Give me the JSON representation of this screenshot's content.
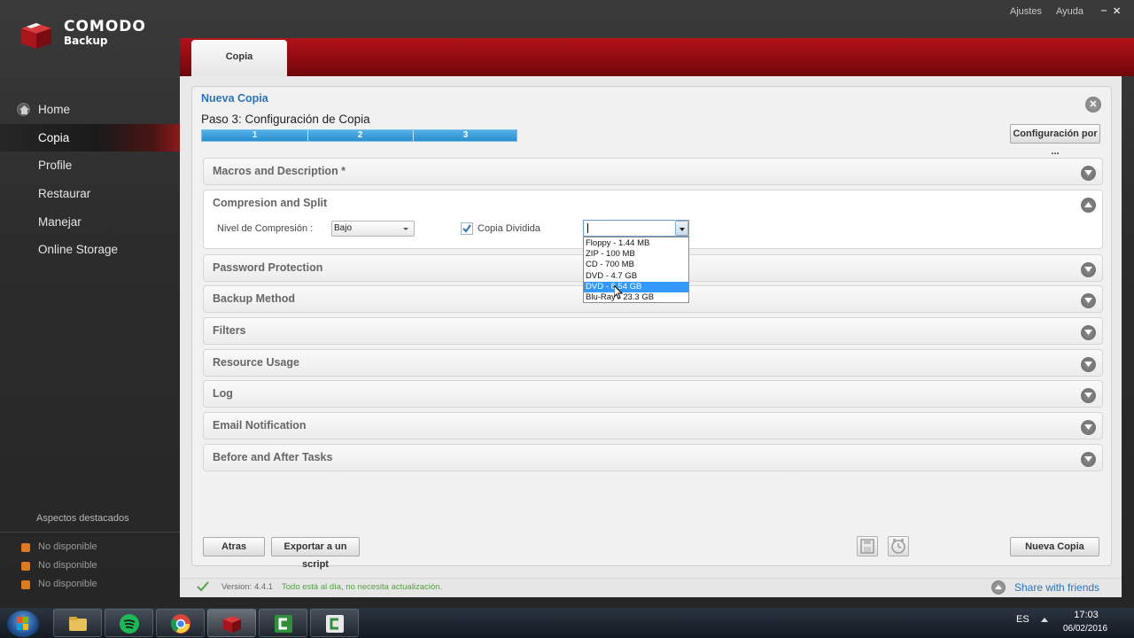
{
  "app": {
    "brand_title": "COMODO",
    "brand_subtitle": "Backup",
    "top_links": [
      "Ajustes",
      "Ayuda"
    ],
    "window_controls": [
      "‒",
      "✕"
    ]
  },
  "sidebar": {
    "items": [
      {
        "label": "Home",
        "icon": "home-icon",
        "active": false
      },
      {
        "label": "Copia",
        "active": true
      },
      {
        "label": "Profile",
        "active": false
      },
      {
        "label": "Restaurar",
        "active": false
      },
      {
        "label": "Manejar",
        "active": false
      },
      {
        "label": "Online Storage",
        "active": false
      }
    ],
    "highlights_title": "Aspectos destacados",
    "highlights": [
      "No disponible",
      "No disponible",
      "No disponible"
    ]
  },
  "header": {
    "tab_label": "Copia"
  },
  "wizard": {
    "title": "Nueva Copia",
    "step_title": "Paso 3: Configuración de Copia",
    "steps": [
      "1",
      "2",
      "3"
    ],
    "config_button": "Configuración por ...",
    "sections": [
      {
        "label": "Macros and Description *"
      },
      {
        "label": "Compresion and Split"
      },
      {
        "label": "Password Protection"
      },
      {
        "label": "Backup Method"
      },
      {
        "label": "Filters"
      },
      {
        "label": "Resource Usage"
      },
      {
        "label": "Log"
      },
      {
        "label": "Email Notification"
      },
      {
        "label": "Before and After Tasks"
      }
    ],
    "compression": {
      "level_label": "Nivel de Compresión :",
      "level_value": "Bajo",
      "split_label": "Copia Dividida",
      "split_checked": true,
      "split_value": "",
      "split_options": [
        "Floppy - 1.44 MB",
        "ZIP - 100 MB",
        "CD - 700 MB",
        "DVD - 4.7 GB",
        "DVD - 8.54 GB",
        "Blu-Ray - 23.3 GB"
      ],
      "split_highlighted": "DVD - 8.54 GB"
    },
    "buttons": {
      "back": "Atras",
      "export": "Exportar a un script",
      "next": "Nueva Copia"
    }
  },
  "status": {
    "version": "Version:  4.4.1",
    "message": "Todo está al día, no necesita actualización.",
    "share": "Share with friends"
  },
  "taskbar": {
    "language": "ES",
    "time": "17:03",
    "date": "06/02/2016"
  },
  "colors": {
    "accent_red": "#8c0b10",
    "link_blue": "#2c73b8",
    "status_green": "#53a043",
    "progress_blue": "#2a8fd0",
    "selection_blue": "#3399ff"
  }
}
